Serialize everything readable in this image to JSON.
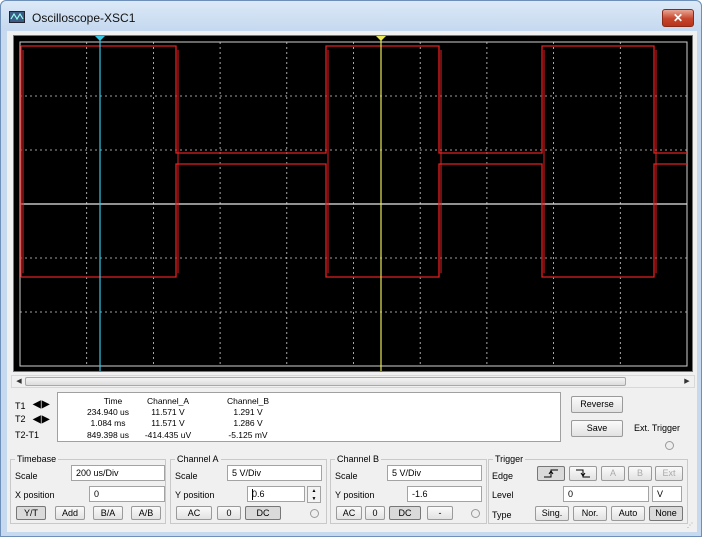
{
  "window": {
    "title": "Oscilloscope-XSC1",
    "close_glyph": "✕"
  },
  "colors": {
    "screen": "#000000",
    "grid": "#d0d0d0",
    "trace_a": "#e02020",
    "trace_b": "#e8e8e8",
    "cursor1": "#35c8e6",
    "cursor2": "#e8e858"
  },
  "cursors": {
    "t1_label": "T1",
    "t2_label": "T2",
    "diff_label": "T2-T1",
    "arrow_glyph": "◀▶"
  },
  "readout": {
    "headers": [
      "Time",
      "Channel_A",
      "Channel_B"
    ],
    "rows": [
      [
        "234.940 us",
        "11.571 V",
        "1.291 V"
      ],
      [
        "1.084 ms",
        "11.571 V",
        "1.286 V"
      ],
      [
        "849.398 us",
        "-414.435 uV",
        "-5.125 mV"
      ]
    ]
  },
  "actions": {
    "reverse": "Reverse",
    "save": "Save",
    "ext_trigger": "Ext. Trigger"
  },
  "timebase": {
    "legend": "Timebase",
    "scale_label": "Scale",
    "scale_value": "200 us/Div",
    "xpos_label": "X position",
    "xpos_value": "0",
    "modes": [
      "Y/T",
      "Add",
      "B/A",
      "A/B"
    ]
  },
  "channel_a": {
    "legend": "Channel A",
    "scale_label": "Scale",
    "scale_value": "5  V/Div",
    "ypos_label": "Y position",
    "ypos_value": "0.6",
    "coupling": [
      "AC",
      "0",
      "DC"
    ]
  },
  "channel_b": {
    "legend": "Channel B",
    "scale_label": "Scale",
    "scale_value": "5  V/Div",
    "ypos_label": "Y position",
    "ypos_value": "-1.6",
    "coupling": [
      "AC",
      "0",
      "DC",
      "-"
    ]
  },
  "trigger": {
    "legend": "Trigger",
    "edge_label": "Edge",
    "level_label": "Level",
    "level_value": "0",
    "level_unit": "V",
    "sources": [
      "A",
      "B",
      "Ext"
    ],
    "type_label": "Type",
    "types": [
      "Sing.",
      "Nor.",
      "Auto",
      "None"
    ]
  }
}
